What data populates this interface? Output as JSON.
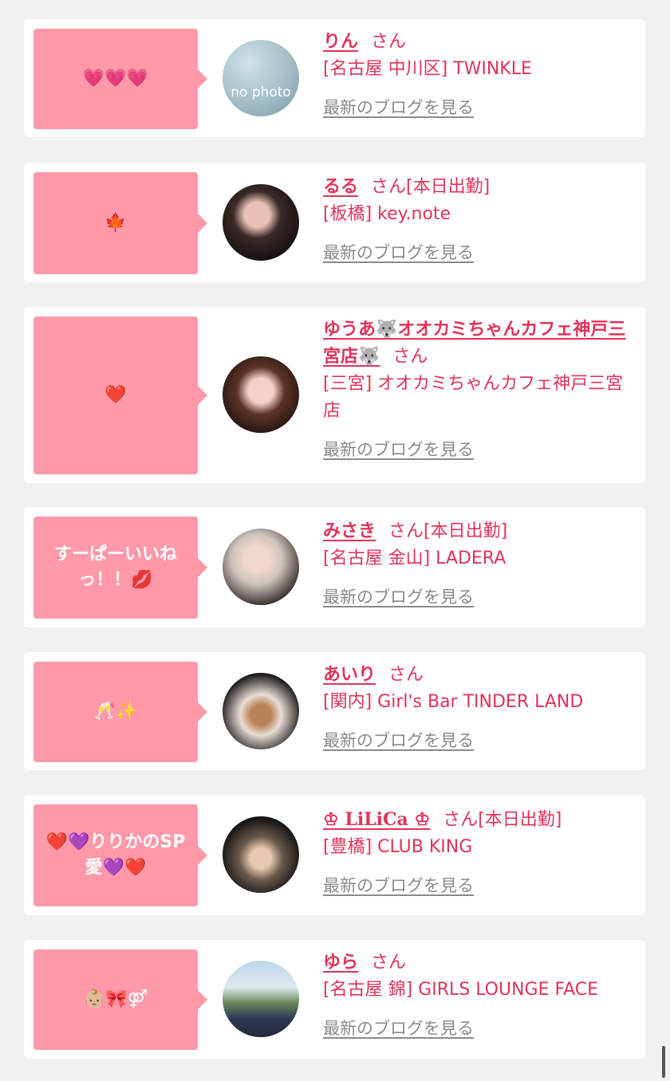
{
  "cards": [
    {
      "message": "💗💗💗",
      "name": "りん",
      "honorific": "さん",
      "status": "",
      "shop": "[名古屋 中川区] TWINKLE",
      "blog_link": "最新のブログを見る",
      "avatar": "no-photo",
      "avatar_text": "no photo"
    },
    {
      "message": "🍁",
      "name": "るる",
      "honorific": "さん",
      "status": "[本日出勤]",
      "shop": "[板橋] key.note",
      "blog_link": "最新のブログを見る",
      "avatar": "photo"
    },
    {
      "message": "❤️",
      "name": "ゆうあ🐺オオカミちゃんカフェ神戸三宮店🐺",
      "honorific": "さん",
      "status": "",
      "shop": "[三宮] オオカミちゃんカフェ神戸三宮店",
      "blog_link": "最新のブログを見る",
      "avatar": "photo"
    },
    {
      "message": "すーぱーいいねっ！！💋",
      "name": "みさき",
      "honorific": "さん",
      "status": "[本日出勤]",
      "shop": "[名古屋 金山] LADERA",
      "blog_link": "最新のブログを見る",
      "avatar": "photo"
    },
    {
      "message": "🥂✨",
      "name": "あいり",
      "honorific": "さん",
      "status": "",
      "shop": "[関内] Girl's Bar TINDER LAND",
      "blog_link": "最新のブログを見る",
      "avatar": "photo"
    },
    {
      "message": "❤️💜りりかのSP愛💜❤️",
      "name": "♔ LiLiCa ♔",
      "honorific": "さん",
      "status": "[本日出勤]",
      "shop": "[豊橋] CLUB KING",
      "blog_link": "最新のブログを見る",
      "avatar": "photo"
    },
    {
      "message": "👶🏼🎀⚤",
      "name": "ゆら",
      "honorific": "さん",
      "status": "",
      "shop": "[名古屋 錦] GIRLS LOUNGE FACE",
      "blog_link": "最新のブログを見る",
      "avatar": "photo"
    }
  ],
  "colors": {
    "accent": "#e0335a",
    "bubble": "#ff98a8",
    "link_gray": "#8a8a8a",
    "background": "#f1f1f1"
  }
}
